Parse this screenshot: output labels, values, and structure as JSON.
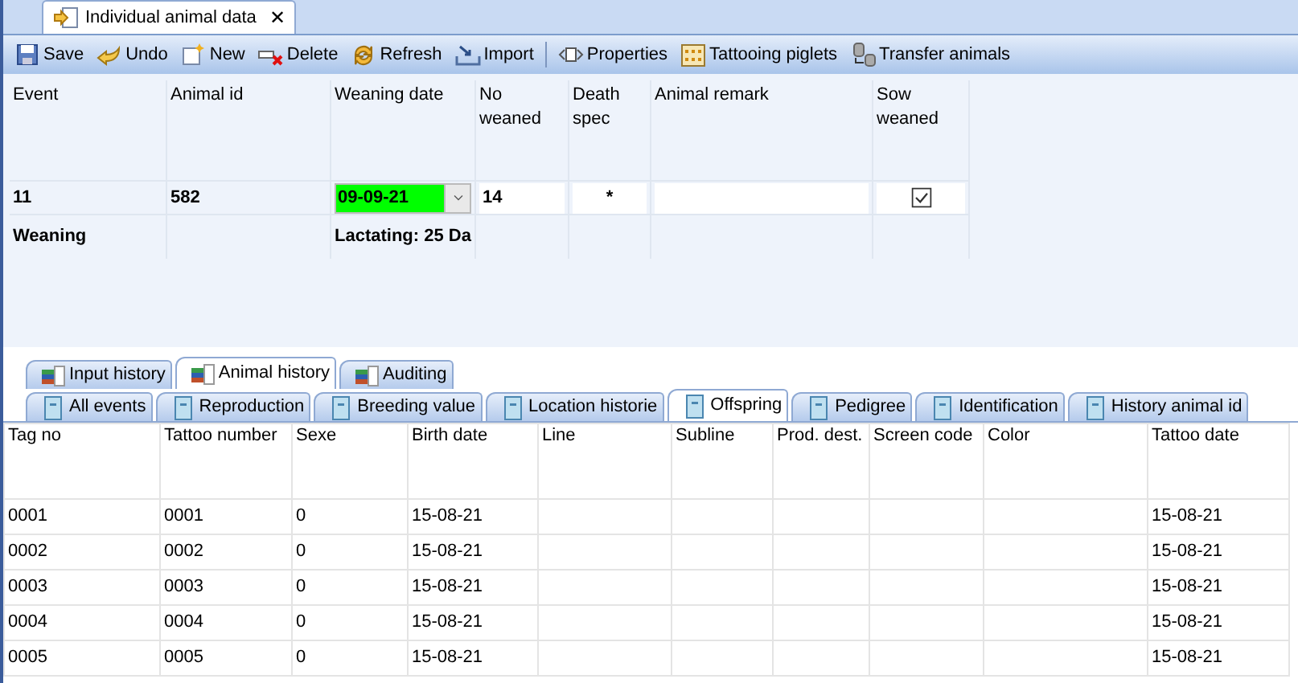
{
  "document_tab": {
    "label": "Individual animal data",
    "selected": true,
    "close": "✕"
  },
  "toolbar": [
    {
      "kind": "button",
      "label": "Save"
    },
    {
      "kind": "button",
      "label": "Undo"
    },
    {
      "kind": "button",
      "label": "New"
    },
    {
      "kind": "button",
      "label": "Delete"
    },
    {
      "kind": "button",
      "label": "Refresh"
    },
    {
      "kind": "button",
      "label": "Import"
    },
    {
      "kind": "separator"
    },
    {
      "kind": "button",
      "label": "Properties"
    },
    {
      "kind": "button",
      "label": "Tattooing piglets"
    },
    {
      "kind": "button",
      "label": "Transfer animals"
    }
  ],
  "form": {
    "columns": [
      "Event",
      "Animal id",
      "Weaning date",
      "No weaned",
      "Death spec",
      "Animal remark",
      "Sow weaned"
    ],
    "values": [
      {
        "kind": "text",
        "value": "11"
      },
      {
        "kind": "text",
        "value": "582"
      },
      {
        "kind": "date",
        "value": "09-09-21",
        "color": "#00ff00"
      },
      {
        "kind": "input",
        "value": "14"
      },
      {
        "kind": "symbol",
        "value": "*"
      },
      {
        "kind": "input"
      },
      {
        "kind": "checkbox",
        "checked": true
      }
    ],
    "summary": {
      "event_type": "Weaning",
      "lactation": "Lactating: 25 Da"
    }
  },
  "history_tabs": [
    {
      "label": "Input history",
      "selected": false
    },
    {
      "label": "Animal history",
      "selected": true
    },
    {
      "label": "Auditing",
      "selected": false
    }
  ],
  "sub_tabs": [
    {
      "label": "All events",
      "selected": false
    },
    {
      "label": "Reproduction",
      "selected": false
    },
    {
      "label": "Breeding value",
      "selected": false
    },
    {
      "label": "Location historie",
      "selected": false
    },
    {
      "label": "Offspring",
      "selected": true
    },
    {
      "label": "Pedigree",
      "selected": false
    },
    {
      "label": "Identification",
      "selected": false
    },
    {
      "label": "History animal id",
      "selected": false
    }
  ],
  "table": {
    "columns": [
      "Tag no",
      "Tattoo number",
      "Sexe",
      "Birth date",
      "Line",
      "Subline",
      "Prod. dest.",
      "Screen code",
      "Color",
      "Tattoo date"
    ],
    "rows": [
      {
        "tag_no": "0001",
        "tattoo_number": "0001",
        "sexe": "0",
        "birth_date": "15-08-21",
        "tattoo_date": "15-08-21"
      },
      {
        "tag_no": "0002",
        "tattoo_number": "0002",
        "sexe": "0",
        "birth_date": "15-08-21",
        "tattoo_date": "15-08-21"
      },
      {
        "tag_no": "0003",
        "tattoo_number": "0003",
        "sexe": "0",
        "birth_date": "15-08-21",
        "tattoo_date": "15-08-21"
      },
      {
        "tag_no": "0004",
        "tattoo_number": "0004",
        "sexe": "0",
        "birth_date": "15-08-21",
        "tattoo_date": "15-08-21"
      },
      {
        "tag_no": "0005",
        "tattoo_number": "0005",
        "sexe": "0",
        "birth_date": "15-08-21",
        "tattoo_date": "15-08-21"
      }
    ]
  }
}
